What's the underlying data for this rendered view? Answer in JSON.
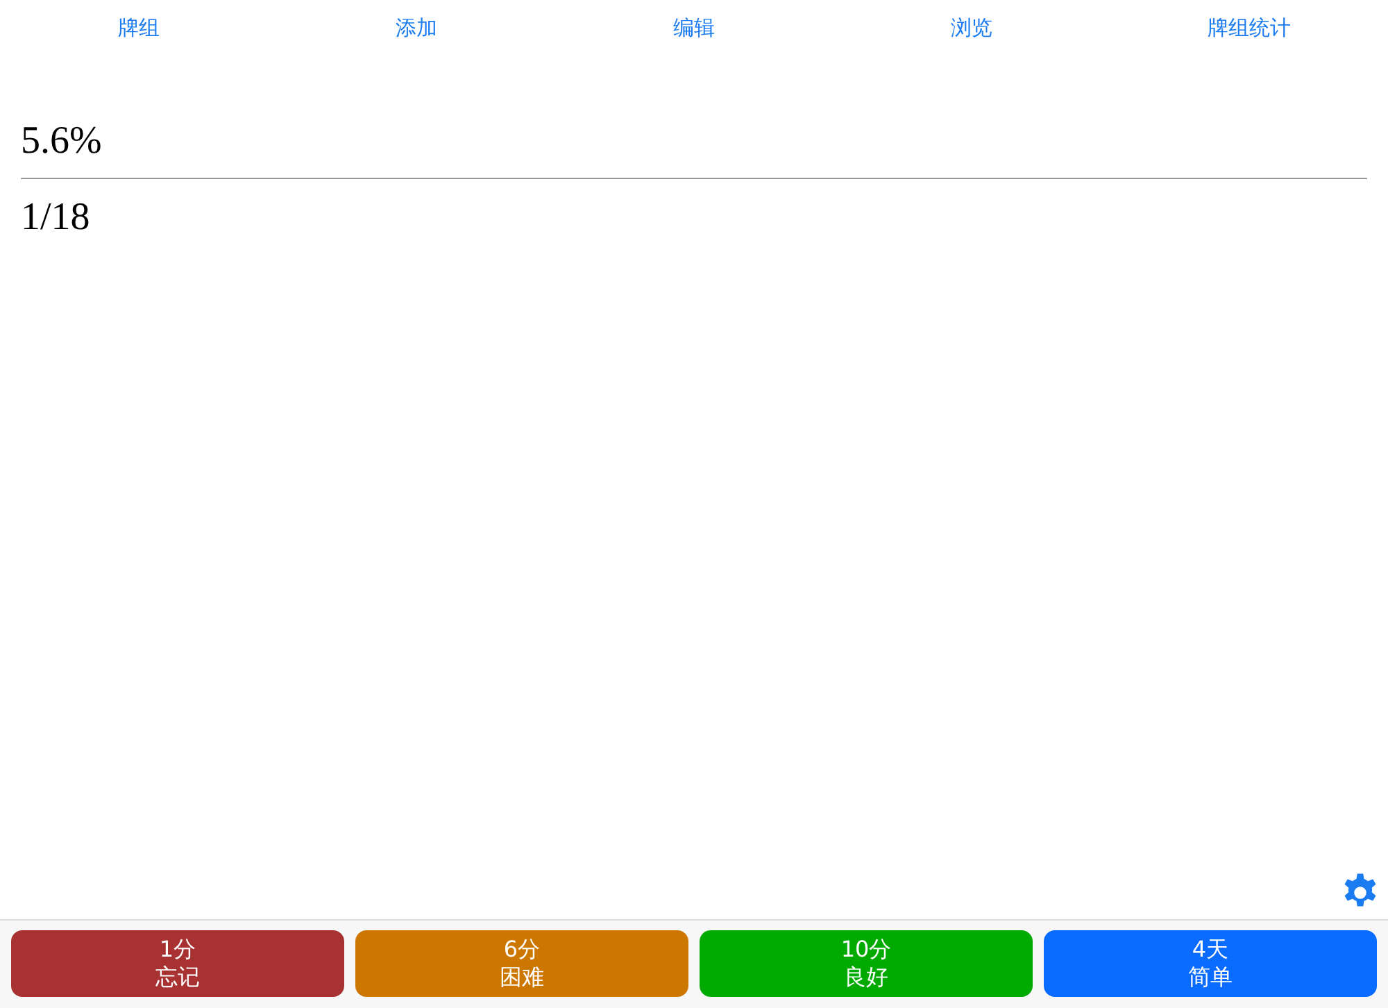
{
  "nav": [
    {
      "label": "牌组"
    },
    {
      "label": "添加"
    },
    {
      "label": "编辑"
    },
    {
      "label": "浏览"
    },
    {
      "label": "牌组统计"
    }
  ],
  "question": "5.6%",
  "answer": "1/18",
  "answer_buttons": [
    {
      "interval": "1分",
      "label": "忘记",
      "color": "#a83232"
    },
    {
      "interval": "6分",
      "label": "困难",
      "color": "#cc7700"
    },
    {
      "interval": "10分",
      "label": "良好",
      "color": "#00aa00"
    },
    {
      "interval": "4天",
      "label": "简单",
      "color": "#0a6cff"
    }
  ]
}
